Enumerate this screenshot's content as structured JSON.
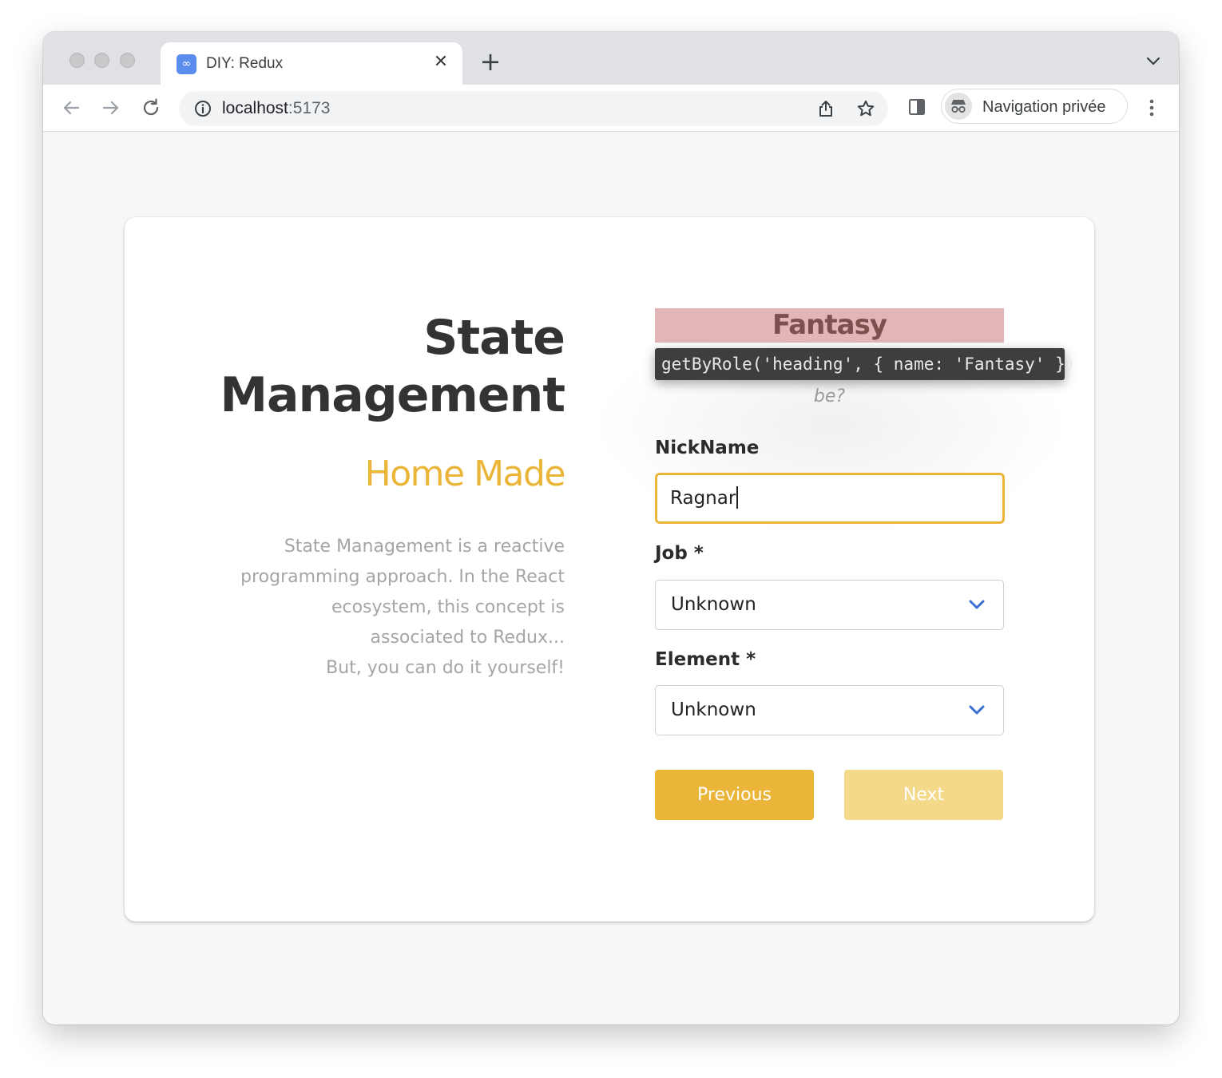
{
  "browser": {
    "tab_title": "DIY: Redux",
    "favicon_glyph": "∞",
    "url_host": "localhost",
    "url_port": ":5173",
    "profile_label": "Navigation privée"
  },
  "page": {
    "title_line1": "State",
    "title_line2": "Management",
    "subtitle": "Home Made",
    "description_lines": [
      "State Management is a reactive",
      "programming approach. In the React",
      "ecosystem, this concept is",
      "associated to Redux...",
      "But, you can do it yourself!"
    ]
  },
  "form": {
    "heading": "Fantasy",
    "tooltip": "getByRole('heading', { name: 'Fantasy' })",
    "question_fragment": "be?",
    "nickname_label": "NickName",
    "nickname_value": "Ragnar",
    "job_label": "Job *",
    "job_value": "Unknown",
    "element_label": "Element *",
    "element_value": "Unknown",
    "previous_label": "Previous",
    "next_label": "Next"
  },
  "colors": {
    "accent": "#ebb53a",
    "accent_disabled": "#f4d98b",
    "chevron": "#3b6fd4",
    "highlight": "#e2b6b6"
  }
}
